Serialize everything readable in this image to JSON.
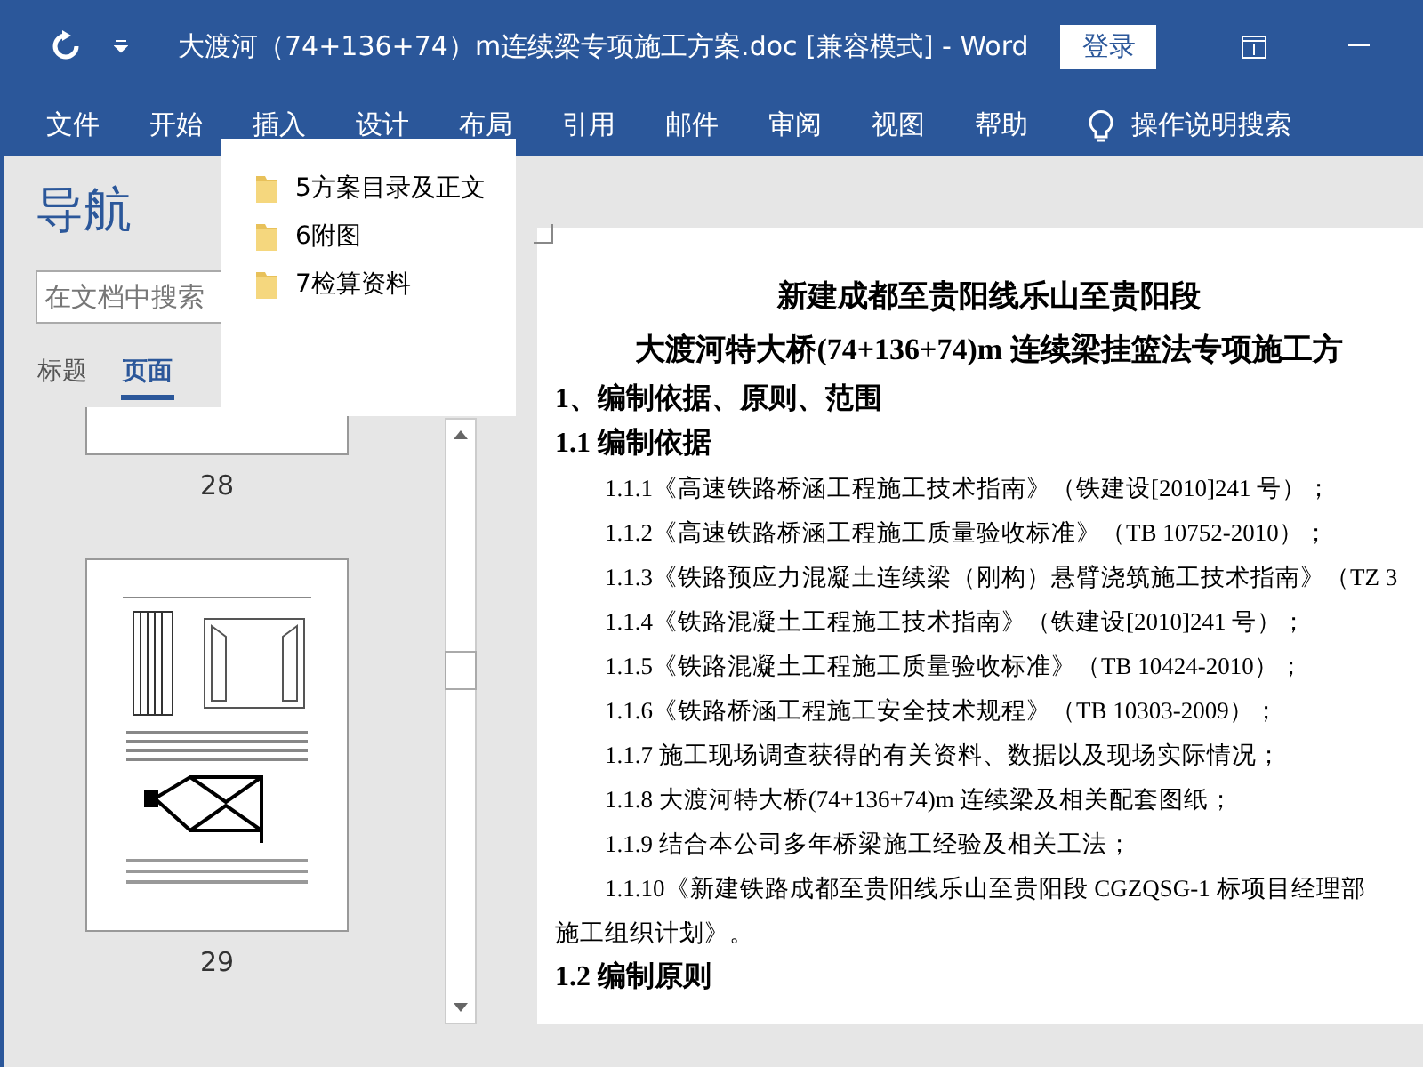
{
  "title_bar": {
    "title": "大渡河（74+136+74）m连续梁专项施工方案.doc [兼容模式]  -  Word",
    "sign_in": "登录"
  },
  "ribbon": {
    "tabs": [
      {
        "label": "文件",
        "selected": false
      },
      {
        "label": "开始",
        "selected": false
      },
      {
        "label": "插入",
        "selected": false
      },
      {
        "label": "设计",
        "selected": false
      },
      {
        "label": "布局",
        "selected": false
      },
      {
        "label": "引用",
        "selected": false
      },
      {
        "label": "邮件",
        "selected": false
      },
      {
        "label": "审阅",
        "selected": false
      },
      {
        "label": "视图",
        "selected": false
      },
      {
        "label": "帮助",
        "selected": false
      }
    ],
    "tell_me": "操作说明搜索"
  },
  "navigation": {
    "title": "导航",
    "search": {
      "placeholder": "在文档中搜索"
    },
    "tabs": [
      {
        "label": "标题",
        "selected": false
      },
      {
        "label": "页面",
        "selected": true
      }
    ],
    "pages": [
      {
        "number": "28",
        "kind": "partial"
      },
      {
        "number": "29",
        "kind": "drawing"
      }
    ]
  },
  "folder_popup": {
    "items": [
      "5方案目录及正文",
      "6附图",
      "7检算资料"
    ]
  },
  "document": {
    "paragraphs": [
      {
        "kind": "title",
        "text": "新建成都至贵阳线乐山至贵阳段"
      },
      {
        "kind": "title",
        "text": "大渡河特大桥(74+136+74)m 连续梁挂篮法专项施工方"
      },
      {
        "kind": "heading",
        "text": "1、编制依据、原则、范围"
      },
      {
        "kind": "heading",
        "text": "1.1 编制依据"
      },
      {
        "kind": "item",
        "text": "1.1.1《高速铁路桥涵工程施工技术指南》（铁建设[2010]241 号）；"
      },
      {
        "kind": "item",
        "text": "1.1.2《高速铁路桥涵工程施工质量验收标准》（TB 10752-2010）；"
      },
      {
        "kind": "item",
        "text": "1.1.3《铁路预应力混凝土连续梁（刚构）悬臂浇筑施工技术指南》（TZ 3"
      },
      {
        "kind": "item",
        "text": "1.1.4《铁路混凝土工程施工技术指南》（铁建设[2010]241 号）；"
      },
      {
        "kind": "item",
        "text": "1.1.5《铁路混凝土工程施工质量验收标准》（TB 10424-2010）；"
      },
      {
        "kind": "item",
        "text": "1.1.6《铁路桥涵工程施工安全技术规程》（TB 10303-2009）；"
      },
      {
        "kind": "item",
        "text": "1.1.7 施工现场调查获得的有关资料、数据以及现场实际情况；"
      },
      {
        "kind": "item",
        "text": "1.1.8 大渡河特大桥(74+136+74)m 连续梁及相关配套图纸；"
      },
      {
        "kind": "item",
        "text": "1.1.9 结合本公司多年桥梁施工经验及相关工法；"
      },
      {
        "kind": "item",
        "text": "1.1.10《新建铁路成都至贵阳线乐山至贵阳段 CGZQSG-1 标项目经理部"
      },
      {
        "kind": "body",
        "text": "施工组织计划》。"
      },
      {
        "kind": "heading",
        "text": "1.2 编制原则"
      }
    ]
  }
}
